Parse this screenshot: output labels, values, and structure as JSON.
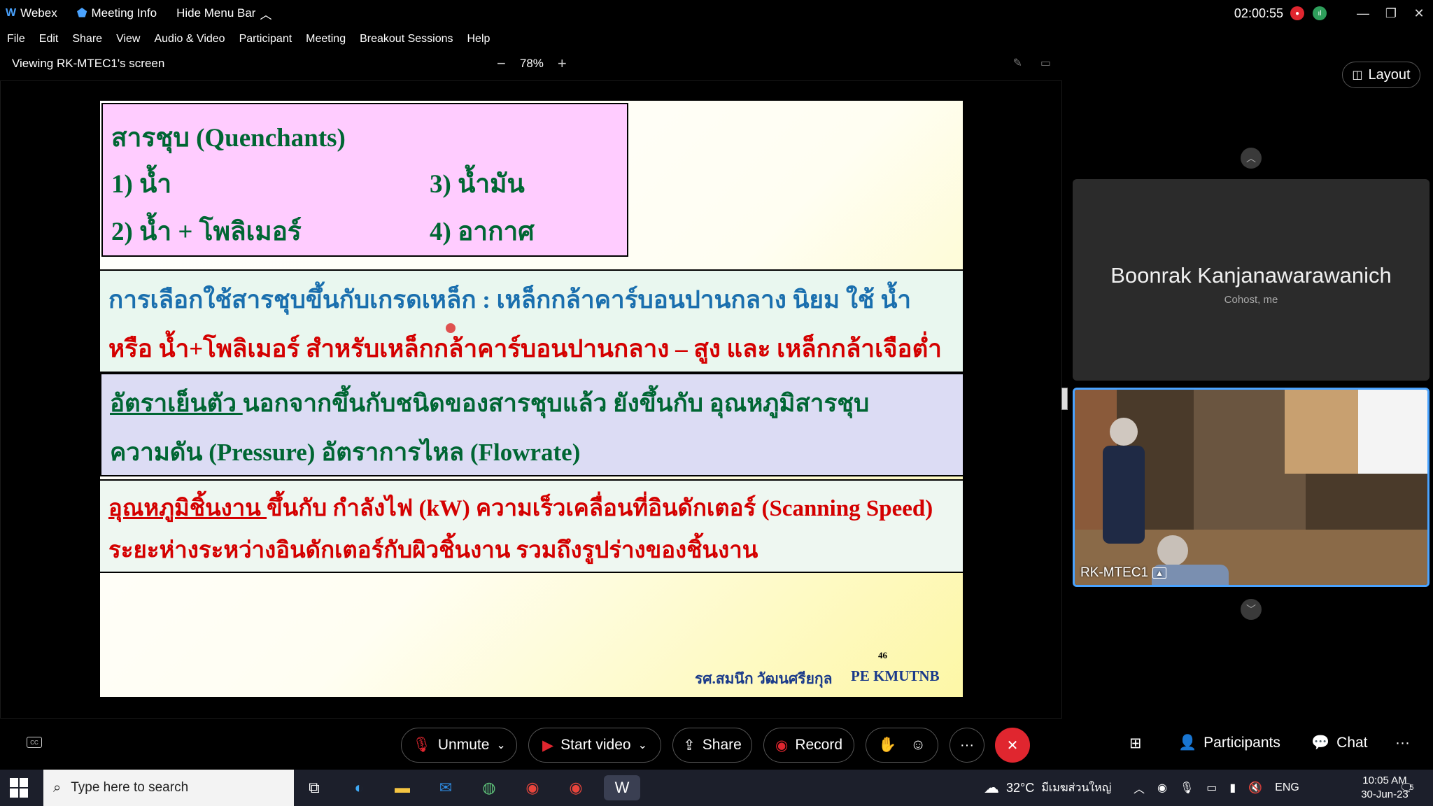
{
  "titlebar": {
    "app_name": "Webex",
    "meeting_info": "Meeting Info",
    "hide_menu_bar": "Hide Menu Bar",
    "timer": "02:00:55"
  },
  "menu": [
    "File",
    "Edit",
    "Share",
    "View",
    "Audio & Video",
    "Participant",
    "Meeting",
    "Breakout Sessions",
    "Help"
  ],
  "viewbar": {
    "viewing": "Viewing RK-MTEC1's screen",
    "zoom": "78%",
    "zoom_out": "−",
    "zoom_in": "+"
  },
  "layout_label": "Layout",
  "slide": {
    "title": "สารชุบ (Quenchants)",
    "items": [
      "1)   น้ำ",
      "3)  น้ำมัน",
      "2)   น้ำ + โพลิเมอร์",
      "4)   อากาศ"
    ],
    "box2_line1": "การเลือกใช้สารชุบขึ้นกับเกรดเหล็ก : เหล็กกล้าคาร์บอนปานกลาง นิยม ใช้ น้ำ",
    "box2_line2": "หรือ น้ำ+โพลิเมอร์ สำหรับเหล็กกล้าคาร์บอนปานกลาง – สูง และ เหล็กกล้าเจือต่ำ",
    "box3_head": "อัตราเย็นตัว ",
    "box3_line1": "นอกจากขึ้นกับชนิดของสารชุบแล้ว ยังขึ้นกับ อุณหภูมิสารชุบ",
    "box3_line2": "ความดัน (Pressure)  อัตราการไหล (Flowrate)",
    "box4_head": "อุณหภูมิชิ้นงาน ",
    "box4_line1": "ขึ้นกับ กำลังไฟ (kW) ความเร็วเคลื่อนที่อินดักเตอร์ (Scanning Speed)",
    "box4_line2": "ระยะห่างระหว่างอินดักเตอร์กับผิวชิ้นงาน รวมถึงรูปร่างของชิ้นงาน",
    "slide_number": "46",
    "author": "รศ.สมนึก  วัฒนศรียกุล",
    "org": "PE KMUTNB"
  },
  "participants": {
    "host_name": "Boonrak Kanjanawarawanich",
    "host_role": "Cohost, me",
    "presenter_label": "RK-MTEC1"
  },
  "controls": {
    "unmute": "Unmute",
    "start_video": "Start video",
    "share": "Share",
    "record": "Record",
    "participants": "Participants",
    "chat": "Chat",
    "more": "···"
  },
  "taskbar": {
    "search_placeholder": "Type here to search",
    "weather": "32°C",
    "location": "มีเมฆส่วนใหญ่",
    "lang": "ENG",
    "time": "10:05 AM",
    "date": "30-Jun-23",
    "notifications": "5"
  },
  "colors": {
    "accent_blue": "#4aa3ff",
    "leave_red": "#e0262f",
    "slide_green": "#006633",
    "slide_blue": "#1a6fae",
    "slide_red": "#d40000"
  }
}
